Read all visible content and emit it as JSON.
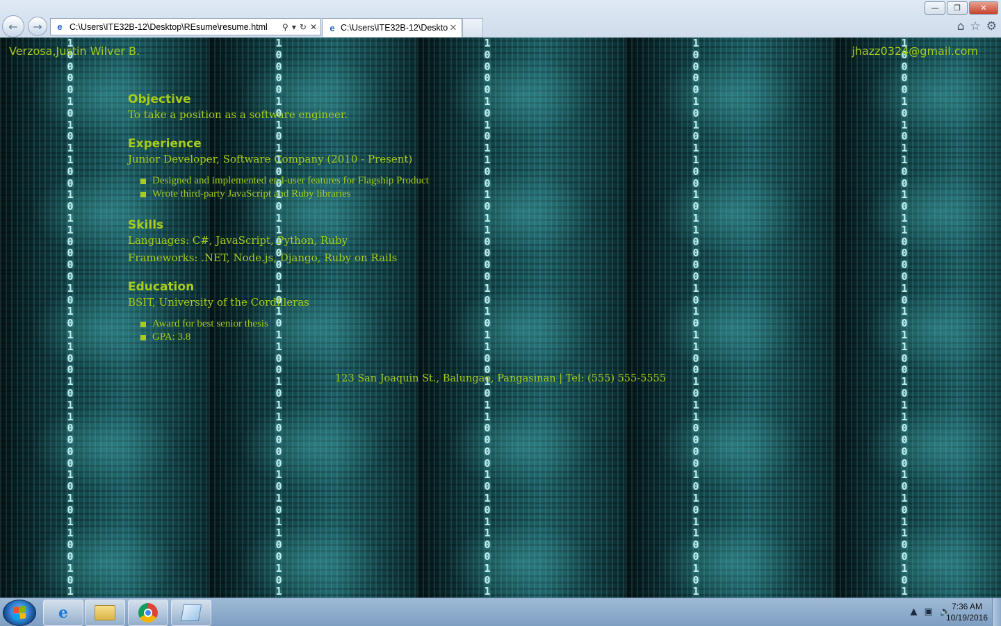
{
  "browser": {
    "address_url": "C:\\Users\\ITE32B-12\\Desktop\\REsume\\resume.html",
    "tab_title": "C:\\Users\\ITE32B-12\\Deskto...",
    "window_controls": {
      "minimize": "—",
      "restore": "❐",
      "close": "✕"
    }
  },
  "page": {
    "header_name": "Verzosa,Justin Wilver B.",
    "header_email": "jhazz0324@gmail.com",
    "objective": {
      "heading": "Objective",
      "text": "To take a position as a software engineer."
    },
    "experience": {
      "heading": "Experience",
      "role": "Junior Developer, Software Company (2010 - Present)",
      "bullets": [
        "Designed and implemented end-user features for Flagship Product",
        "Wrote third-party JavaScript and Ruby libraries"
      ]
    },
    "skills": {
      "heading": "Skills",
      "languages": "Languages: C#, JavaScript, Python, Ruby",
      "frameworks": "Frameworks: .NET, Node.js, Django, Ruby on Rails"
    },
    "education": {
      "heading": "Education",
      "degree": "BSIT, University of the Cordilleras",
      "bullets": [
        "Award for best senior thesis",
        "GPA: 3.8"
      ]
    },
    "footer": "123 San Joaquin St., Balungao, Pangasinan | Tel: (555) 555-5555"
  },
  "taskbar": {
    "clock_time": "7:36 AM",
    "clock_date": "10/19/2016",
    "pinned": [
      "internet-explorer-icon",
      "file-explorer-icon",
      "chrome-icon",
      "notepad-icon"
    ]
  },
  "colors": {
    "text_accent": "#a8cc1a",
    "background": "#0d3135"
  }
}
